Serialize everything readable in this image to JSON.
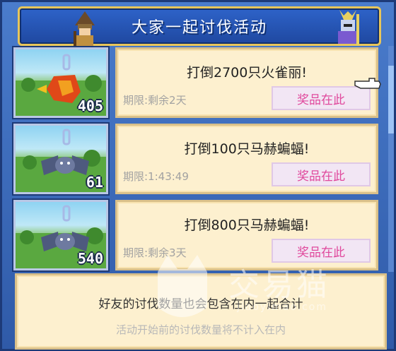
{
  "header": {
    "title": "大家一起讨伐活动"
  },
  "missions": [
    {
      "monster_icon": "firebird-icon",
      "count": "405",
      "goal": "打倒2700只火雀丽!",
      "deadline": "期限:剩余2天",
      "prize_label": "奖品在此"
    },
    {
      "monster_icon": "bat-icon",
      "count": "61",
      "goal": "打倒100只马赫蝙蝠!",
      "deadline": "期限:1:43:49",
      "prize_label": "奖品在此"
    },
    {
      "monster_icon": "bat-icon",
      "count": "540",
      "goal": "打倒800只马赫蝙蝠!",
      "deadline": "期限:剩余3天",
      "prize_label": "奖品在此"
    }
  ],
  "footer": {
    "line1": "好友的讨伐数量也会包含在内一起合计",
    "line2": "活动开始前的讨伐数量将不计入在内"
  },
  "watermark": {
    "text": "交易猫",
    "sub": "jiaoyimao.com"
  },
  "colors": {
    "frame": "#3f6fbf",
    "card": "#fdf0cf",
    "prize_text": "#e0489c",
    "title_border": "#e8c65a"
  }
}
